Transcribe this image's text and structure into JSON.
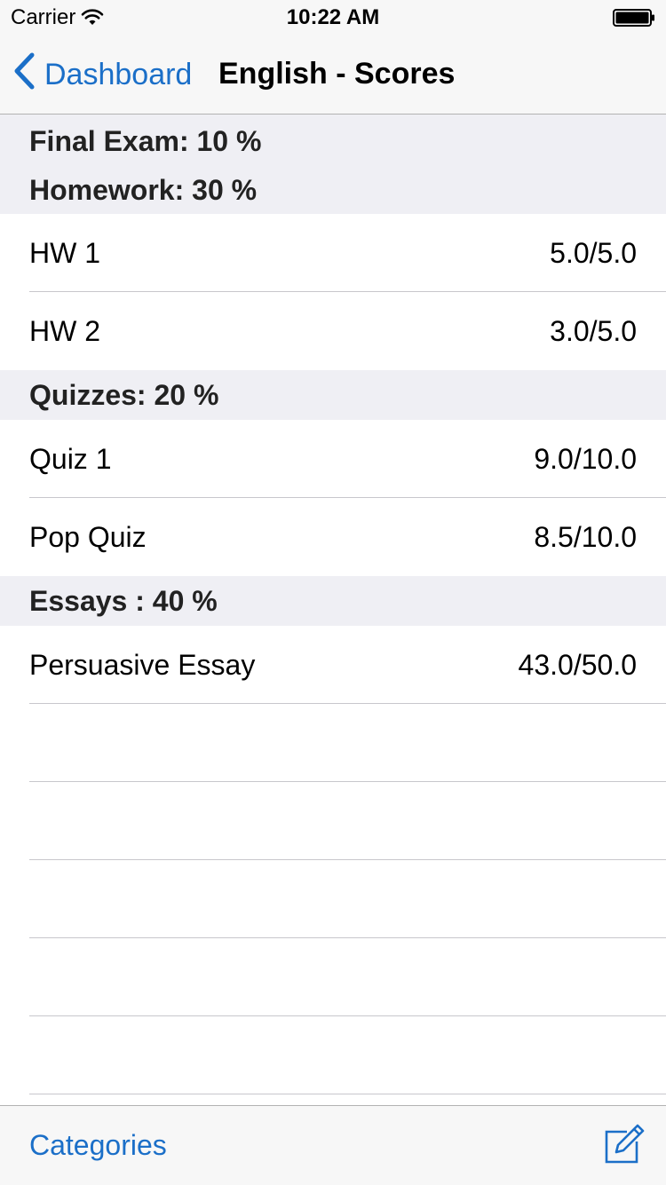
{
  "status_bar": {
    "carrier": "Carrier",
    "time": "10:22 AM",
    "icons": [
      "wifi-icon",
      "battery-icon"
    ]
  },
  "nav": {
    "back_label": "Dashboard",
    "title": "English - Scores",
    "back_icon": "chevron-left-icon"
  },
  "sections": {
    "final_exam": {
      "header": "Final Exam: 10 %"
    },
    "homework": {
      "header": "Homework: 30 %",
      "items": [
        {
          "name": "HW 1",
          "score": "5.0/5.0"
        },
        {
          "name": "HW 2",
          "score": "3.0/5.0"
        }
      ]
    },
    "quizzes": {
      "header": "Quizzes: 20 %",
      "items": [
        {
          "name": "Quiz 1",
          "score": "9.0/10.0"
        },
        {
          "name": "Pop Quiz",
          "score": "8.5/10.0"
        }
      ]
    },
    "essays": {
      "header": "Essays : 40 %",
      "items": [
        {
          "name": "Persuasive Essay",
          "score": "43.0/50.0"
        }
      ]
    }
  },
  "toolbar": {
    "categories_label": "Categories",
    "compose_icon": "compose-icon"
  },
  "colors": {
    "accent": "#1b6fc8",
    "bar_background": "#f7f7f7",
    "section_background": "#efeff4",
    "separator": "#c8c7cc"
  }
}
